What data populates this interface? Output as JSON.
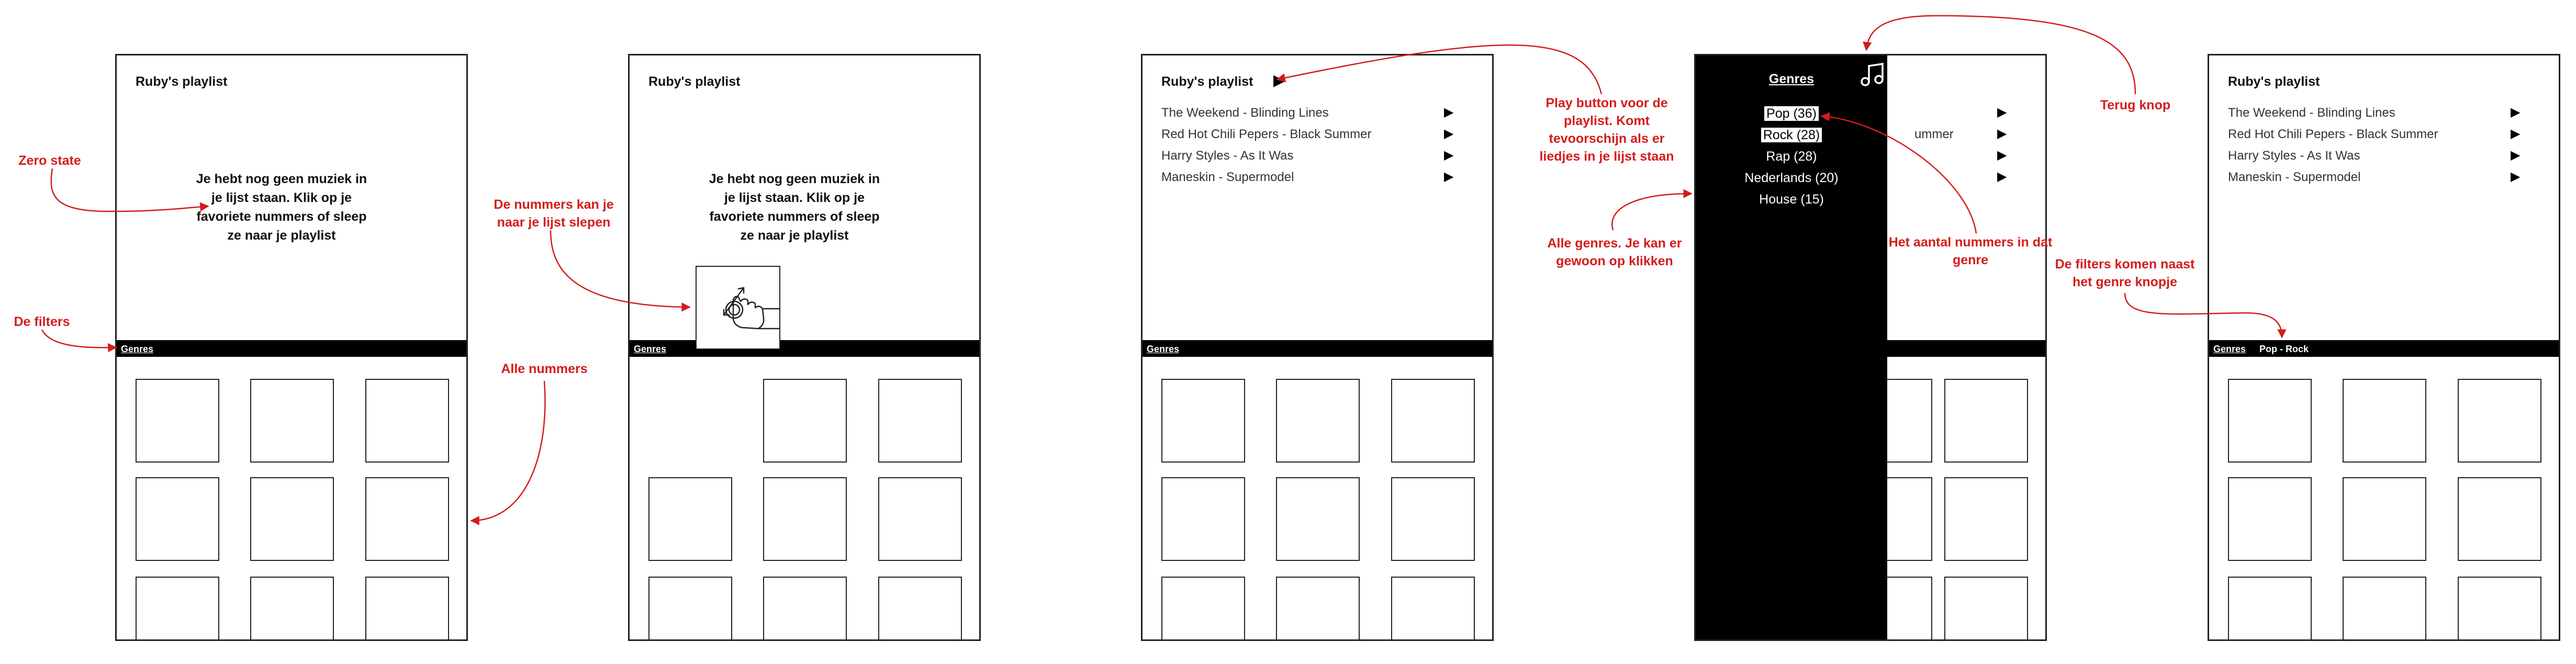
{
  "screens": {
    "s1": {
      "title": "Ruby's playlist",
      "zero_state": "Je hebt nog geen muziek in je lijst staan. Klik op je favoriete nummers of sleep ze naar je playlist",
      "filter_label": "Genres"
    },
    "s2": {
      "title": "Ruby's playlist",
      "zero_state": "Je hebt nog geen muziek in je lijst staan. Klik op je favoriete nummers of sleep ze naar je playlist",
      "filter_label": "Genres"
    },
    "s3": {
      "title": "Ruby's playlist",
      "play_icon": "play-icon",
      "filter_label": "Genres",
      "songs": [
        "The Weekend - Blinding Lines",
        "Red Hot Chili Pepers - Black Summer",
        "Harry Styles - As It Was",
        "Maneskin - Supermodel"
      ]
    },
    "s4": {
      "drawer_title": "Genres",
      "back_icon": "music-note-icon",
      "genres": [
        "Pop (36)",
        "Rock (28)",
        "Rap (28)",
        "Nederlands (20)",
        "House (15)"
      ],
      "behind_text": "ummer"
    },
    "s5": {
      "title": "Ruby's playlist",
      "filter_label": "Genres",
      "active_filter": "Pop - Rock",
      "songs": [
        "The Weekend - Blinding Lines",
        "Red Hot Chili Pepers - Black Summer",
        "Harry Styles - As It Was",
        "Maneskin - Supermodel"
      ]
    }
  },
  "annotations": {
    "zero_state": "Zero state",
    "filters": "De filters",
    "all_songs": "Alle nummers",
    "drag": "De nummers kan je naar je lijst slepen",
    "play_button": "Play button voor de playlist. Komt tevoorschijn als er liedjes in je lijst staan",
    "all_genres": "Alle genres. Je kan er gewoon op klikken",
    "genre_count": "Het aantal nummers in dat genre",
    "back_button": "Terug knop",
    "filters_next": "De filters komen naast het genre knopje"
  },
  "colors": {
    "annotation": "#d41c1c",
    "bar": "#000000"
  }
}
